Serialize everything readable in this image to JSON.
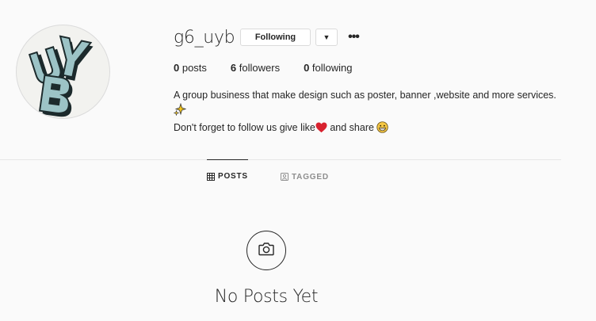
{
  "profile": {
    "username": "g6_uyb",
    "following_button": "Following",
    "dropdown_glyph": "▼",
    "more_glyph": "•••",
    "avatar_letters": "UYB"
  },
  "stats": {
    "posts_count": "0",
    "posts_label": " posts",
    "followers_count": "6",
    "followers_label": " followers",
    "following_count": "0",
    "following_label": " following"
  },
  "bio": {
    "line1": "A group business that make design such as poster, banner ,website and more services.",
    "line3_a": "Don't forget to follow us give like",
    "line3_b": " and share ",
    "sparkles_icon": "sparkles-icon",
    "heart_icon": "red-heart-icon",
    "grin_icon": "grinning-face-icon"
  },
  "tabs": [
    {
      "label": "POSTS",
      "active": true
    },
    {
      "label": "TAGGED",
      "active": false
    }
  ],
  "empty_state": {
    "icon": "camera-icon",
    "message": "No Posts Yet"
  },
  "colors": {
    "text": "#262626",
    "muted": "#8e8e8e",
    "border": "#dbdbdb",
    "background": "#fafafa",
    "heart": "#d8222f"
  }
}
